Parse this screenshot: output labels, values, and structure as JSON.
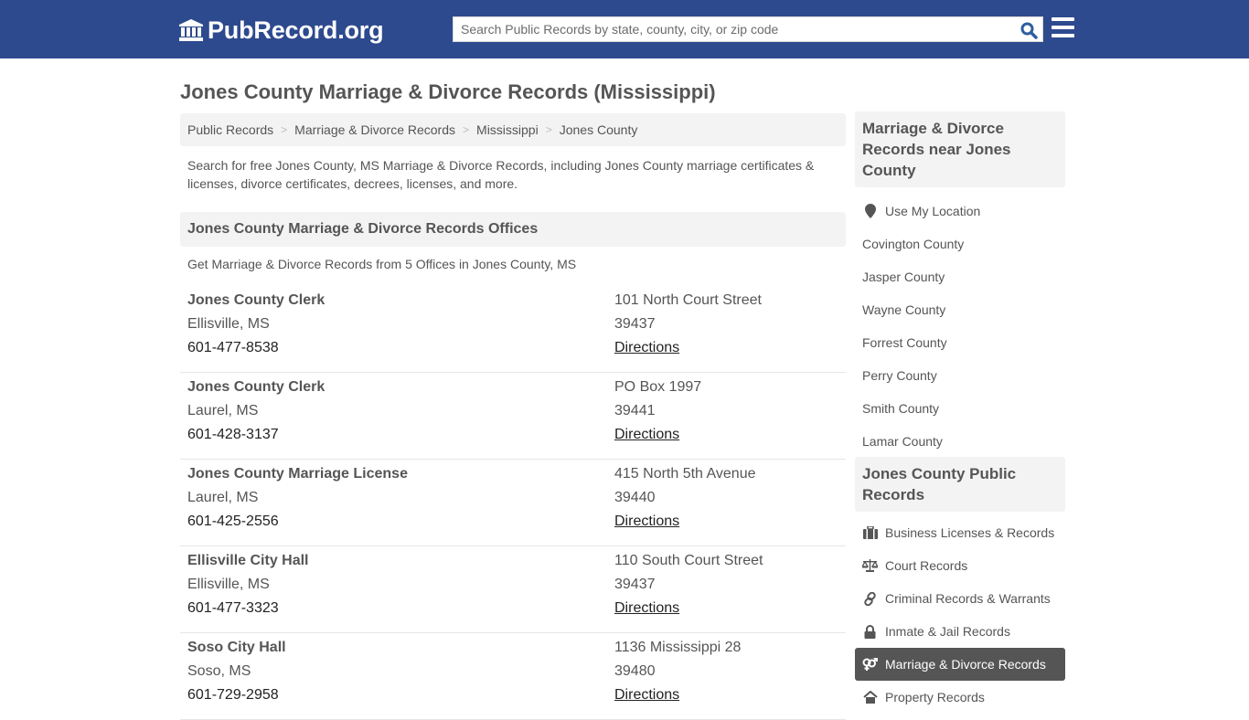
{
  "header": {
    "logo_text": "PubRecord.org",
    "search_placeholder": "Search Public Records by state, county, city, or zip code",
    "search_value": "",
    "colors": {
      "bar": "#2e4a8e",
      "search_icon": "#2e5fa0"
    }
  },
  "page": {
    "title": "Jones County Marriage & Divorce Records (Mississippi)",
    "breadcrumb": [
      {
        "label": "Public Records"
      },
      {
        "label": "Marriage & Divorce Records"
      },
      {
        "label": "Mississippi"
      },
      {
        "label": "Jones County"
      }
    ],
    "intro": "Search for free Jones County, MS Marriage & Divorce Records, including Jones County marriage certificates & licenses, divorce certificates, decrees, licenses, and more."
  },
  "offices_section": {
    "heading": "Jones County Marriage & Divorce Records Offices",
    "subheading": "Get Marriage & Divorce Records from 5 Offices in Jones County, MS",
    "directions_label": "Directions",
    "offices": [
      {
        "name": "Jones County Clerk",
        "city": "Ellisville, MS",
        "phone": "601-477-8538",
        "address": "101 North Court Street",
        "zip": "39437"
      },
      {
        "name": "Jones County Clerk",
        "city": "Laurel, MS",
        "phone": "601-428-3137",
        "address": "PO Box 1997",
        "zip": "39441"
      },
      {
        "name": "Jones County Marriage License",
        "city": "Laurel, MS",
        "phone": "601-425-2556",
        "address": "415 North 5th Avenue",
        "zip": "39440"
      },
      {
        "name": "Ellisville City Hall",
        "city": "Ellisville, MS",
        "phone": "601-477-3323",
        "address": "110 South Court Street",
        "zip": "39437"
      },
      {
        "name": "Soso City Hall",
        "city": "Soso, MS",
        "phone": "601-729-2958",
        "address": "1136 Mississippi 28",
        "zip": "39480"
      }
    ]
  },
  "sidebar": {
    "nearby": {
      "heading": "Marriage & Divorce Records near Jones County",
      "use_location": {
        "label": "Use My Location",
        "icon": "map-marker-icon"
      },
      "counties": [
        "Covington County",
        "Jasper County",
        "Wayne County",
        "Forrest County",
        "Perry County",
        "Smith County",
        "Lamar County"
      ]
    },
    "public_records": {
      "heading": "Jones County Public Records",
      "items": [
        {
          "label": "Business Licenses & Records",
          "icon": "briefcase-icon",
          "active": false
        },
        {
          "label": "Court Records",
          "icon": "balance-scale-icon",
          "active": false
        },
        {
          "label": "Criminal Records & Warrants",
          "icon": "chain-link-icon",
          "active": false
        },
        {
          "label": "Inmate & Jail Records",
          "icon": "lock-icon",
          "active": false
        },
        {
          "label": "Marriage & Divorce Records",
          "icon": "venus-mars-icon",
          "active": true
        },
        {
          "label": "Property Records",
          "icon": "home-icon",
          "active": false
        }
      ],
      "active_color": "#555555"
    }
  }
}
